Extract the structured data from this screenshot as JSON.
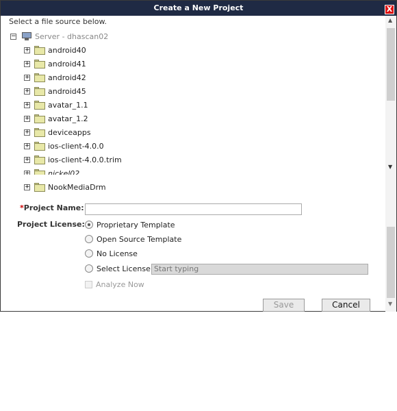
{
  "dialog": {
    "title": "Create a New Project",
    "close_label": "X"
  },
  "tree": {
    "hint": "Select a file source below.",
    "root_label": "Server - dhascan02",
    "root_toggle": "−",
    "item_toggle": "+",
    "items": [
      {
        "label": "android40"
      },
      {
        "label": "android41"
      },
      {
        "label": "android42"
      },
      {
        "label": "android45"
      },
      {
        "label": "avatar_1.1"
      },
      {
        "label": "avatar_1.2"
      },
      {
        "label": "deviceapps"
      },
      {
        "label": "ios-client-4.0.0"
      },
      {
        "label": "ios-client-4.0.0.trim"
      },
      {
        "label": "nickel02"
      },
      {
        "label": "NookMediaDrm"
      }
    ]
  },
  "form": {
    "required_mark": "*",
    "project_name_label": "Project Name:",
    "project_name_value": "",
    "project_license_label": "Project License:",
    "license_options": [
      {
        "label": "Proprietary Template",
        "selected": true
      },
      {
        "label": "Open Source Template",
        "selected": false
      },
      {
        "label": "No License",
        "selected": false
      },
      {
        "label": "Select License:",
        "selected": false
      }
    ],
    "select_license_placeholder": "Start typing",
    "analyze_now_label": "Analyze Now",
    "analyze_now_checked": false
  },
  "buttons": {
    "save_label": "Save",
    "cancel_label": "Cancel"
  },
  "icons": {
    "server": "monitor-icon",
    "folder": "folder-icon",
    "expand": "plus-box-icon",
    "collapse": "minus-box-icon"
  },
  "colors": {
    "titlebar": "#1f2a44",
    "close_button": "#dd1111",
    "folder": "#e8e8a8",
    "required": "#cc0000"
  }
}
